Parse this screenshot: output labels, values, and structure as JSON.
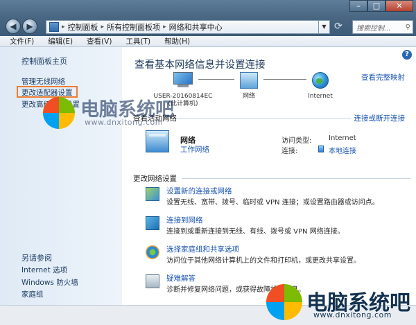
{
  "address_bar": {
    "crumbs": [
      "控制面板",
      "所有控制面板项",
      "网络和共享中心"
    ],
    "search_placeholder": "搜索控制..."
  },
  "menu": [
    "文件(F)",
    "编辑(E)",
    "查看(V)",
    "工具(T)",
    "帮助(H)"
  ],
  "left_nav": {
    "home": "控制面板主页",
    "items": [
      "管理无线网络",
      "更改适配器设置",
      "更改高级共享设置"
    ],
    "see_also_title": "另请参阅",
    "see_also": [
      "Internet 选项",
      "Windows 防火墙",
      "家庭组"
    ]
  },
  "main": {
    "title": "查看基本网络信息并设置连接",
    "view_full_map": "查看完整映射",
    "map": {
      "computer_label": "USER-20160814EC",
      "computer_sub": "(此计算机)",
      "network_label": "网络",
      "internet_label": "Internet"
    },
    "active_networks": "查看活动网络",
    "connect_disconnect": "连接或断开连接",
    "network": {
      "name": "网络",
      "type": "工作网络",
      "access_type_label": "访问类型:",
      "access_type_value": "Internet",
      "connections_label": "连接:",
      "connections_value": "本地连接"
    },
    "change_settings": "更改网络设置",
    "tasks": [
      {
        "title": "设置新的连接或网络",
        "desc": "设置无线、宽带、拨号、临时或 VPN 连接；或设置路由器或访问点。"
      },
      {
        "title": "连接到网络",
        "desc": "连接到或重新连接到无线、有线、拨号或 VPN 网络连接。"
      },
      {
        "title": "选择家庭组和共享选项",
        "desc": "访问位于其他网络计算机上的文件和打印机，或更改共享设置。"
      },
      {
        "title": "疑难解答",
        "desc": "诊断并修复网络问题，或获得故障排除信息。"
      }
    ]
  },
  "watermark": {
    "text": "电脑系统吧",
    "url": "www.dnxitong.com"
  },
  "colors": {
    "link": "#1a55b0",
    "highlight_box": "#ed7d31",
    "wm_red": "#f04e23",
    "wm_green": "#7cbb00",
    "wm_blue": "#00a1f1",
    "wm_yellow": "#ffbb00"
  }
}
